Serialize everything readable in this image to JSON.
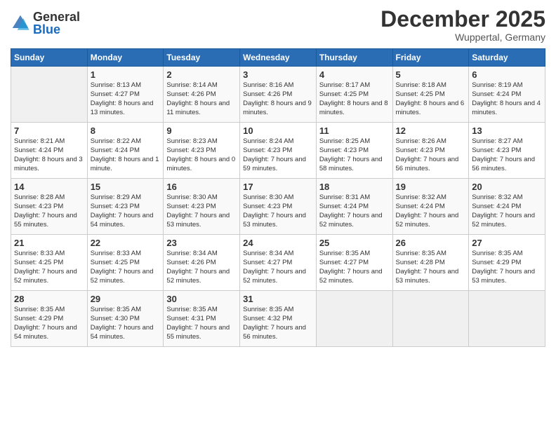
{
  "header": {
    "logo_general": "General",
    "logo_blue": "Blue",
    "month_title": "December 2025",
    "location": "Wuppertal, Germany"
  },
  "weekdays": [
    "Sunday",
    "Monday",
    "Tuesday",
    "Wednesday",
    "Thursday",
    "Friday",
    "Saturday"
  ],
  "weeks": [
    [
      {
        "num": "",
        "empty": true
      },
      {
        "num": "1",
        "sunrise": "Sunrise: 8:13 AM",
        "sunset": "Sunset: 4:27 PM",
        "daylight": "Daylight: 8 hours and 13 minutes."
      },
      {
        "num": "2",
        "sunrise": "Sunrise: 8:14 AM",
        "sunset": "Sunset: 4:26 PM",
        "daylight": "Daylight: 8 hours and 11 minutes."
      },
      {
        "num": "3",
        "sunrise": "Sunrise: 8:16 AM",
        "sunset": "Sunset: 4:26 PM",
        "daylight": "Daylight: 8 hours and 9 minutes."
      },
      {
        "num": "4",
        "sunrise": "Sunrise: 8:17 AM",
        "sunset": "Sunset: 4:25 PM",
        "daylight": "Daylight: 8 hours and 8 minutes."
      },
      {
        "num": "5",
        "sunrise": "Sunrise: 8:18 AM",
        "sunset": "Sunset: 4:25 PM",
        "daylight": "Daylight: 8 hours and 6 minutes."
      },
      {
        "num": "6",
        "sunrise": "Sunrise: 8:19 AM",
        "sunset": "Sunset: 4:24 PM",
        "daylight": "Daylight: 8 hours and 4 minutes."
      }
    ],
    [
      {
        "num": "7",
        "sunrise": "Sunrise: 8:21 AM",
        "sunset": "Sunset: 4:24 PM",
        "daylight": "Daylight: 8 hours and 3 minutes."
      },
      {
        "num": "8",
        "sunrise": "Sunrise: 8:22 AM",
        "sunset": "Sunset: 4:24 PM",
        "daylight": "Daylight: 8 hours and 1 minute."
      },
      {
        "num": "9",
        "sunrise": "Sunrise: 8:23 AM",
        "sunset": "Sunset: 4:23 PM",
        "daylight": "Daylight: 8 hours and 0 minutes."
      },
      {
        "num": "10",
        "sunrise": "Sunrise: 8:24 AM",
        "sunset": "Sunset: 4:23 PM",
        "daylight": "Daylight: 7 hours and 59 minutes."
      },
      {
        "num": "11",
        "sunrise": "Sunrise: 8:25 AM",
        "sunset": "Sunset: 4:23 PM",
        "daylight": "Daylight: 7 hours and 58 minutes."
      },
      {
        "num": "12",
        "sunrise": "Sunrise: 8:26 AM",
        "sunset": "Sunset: 4:23 PM",
        "daylight": "Daylight: 7 hours and 56 minutes."
      },
      {
        "num": "13",
        "sunrise": "Sunrise: 8:27 AM",
        "sunset": "Sunset: 4:23 PM",
        "daylight": "Daylight: 7 hours and 56 minutes."
      }
    ],
    [
      {
        "num": "14",
        "sunrise": "Sunrise: 8:28 AM",
        "sunset": "Sunset: 4:23 PM",
        "daylight": "Daylight: 7 hours and 55 minutes."
      },
      {
        "num": "15",
        "sunrise": "Sunrise: 8:29 AM",
        "sunset": "Sunset: 4:23 PM",
        "daylight": "Daylight: 7 hours and 54 minutes."
      },
      {
        "num": "16",
        "sunrise": "Sunrise: 8:30 AM",
        "sunset": "Sunset: 4:23 PM",
        "daylight": "Daylight: 7 hours and 53 minutes."
      },
      {
        "num": "17",
        "sunrise": "Sunrise: 8:30 AM",
        "sunset": "Sunset: 4:23 PM",
        "daylight": "Daylight: 7 hours and 53 minutes."
      },
      {
        "num": "18",
        "sunrise": "Sunrise: 8:31 AM",
        "sunset": "Sunset: 4:24 PM",
        "daylight": "Daylight: 7 hours and 52 minutes."
      },
      {
        "num": "19",
        "sunrise": "Sunrise: 8:32 AM",
        "sunset": "Sunset: 4:24 PM",
        "daylight": "Daylight: 7 hours and 52 minutes."
      },
      {
        "num": "20",
        "sunrise": "Sunrise: 8:32 AM",
        "sunset": "Sunset: 4:24 PM",
        "daylight": "Daylight: 7 hours and 52 minutes."
      }
    ],
    [
      {
        "num": "21",
        "sunrise": "Sunrise: 8:33 AM",
        "sunset": "Sunset: 4:25 PM",
        "daylight": "Daylight: 7 hours and 52 minutes."
      },
      {
        "num": "22",
        "sunrise": "Sunrise: 8:33 AM",
        "sunset": "Sunset: 4:25 PM",
        "daylight": "Daylight: 7 hours and 52 minutes."
      },
      {
        "num": "23",
        "sunrise": "Sunrise: 8:34 AM",
        "sunset": "Sunset: 4:26 PM",
        "daylight": "Daylight: 7 hours and 52 minutes."
      },
      {
        "num": "24",
        "sunrise": "Sunrise: 8:34 AM",
        "sunset": "Sunset: 4:27 PM",
        "daylight": "Daylight: 7 hours and 52 minutes."
      },
      {
        "num": "25",
        "sunrise": "Sunrise: 8:35 AM",
        "sunset": "Sunset: 4:27 PM",
        "daylight": "Daylight: 7 hours and 52 minutes."
      },
      {
        "num": "26",
        "sunrise": "Sunrise: 8:35 AM",
        "sunset": "Sunset: 4:28 PM",
        "daylight": "Daylight: 7 hours and 53 minutes."
      },
      {
        "num": "27",
        "sunrise": "Sunrise: 8:35 AM",
        "sunset": "Sunset: 4:29 PM",
        "daylight": "Daylight: 7 hours and 53 minutes."
      }
    ],
    [
      {
        "num": "28",
        "sunrise": "Sunrise: 8:35 AM",
        "sunset": "Sunset: 4:29 PM",
        "daylight": "Daylight: 7 hours and 54 minutes."
      },
      {
        "num": "29",
        "sunrise": "Sunrise: 8:35 AM",
        "sunset": "Sunset: 4:30 PM",
        "daylight": "Daylight: 7 hours and 54 minutes."
      },
      {
        "num": "30",
        "sunrise": "Sunrise: 8:35 AM",
        "sunset": "Sunset: 4:31 PM",
        "daylight": "Daylight: 7 hours and 55 minutes."
      },
      {
        "num": "31",
        "sunrise": "Sunrise: 8:35 AM",
        "sunset": "Sunset: 4:32 PM",
        "daylight": "Daylight: 7 hours and 56 minutes."
      },
      {
        "num": "",
        "empty": true
      },
      {
        "num": "",
        "empty": true
      },
      {
        "num": "",
        "empty": true
      }
    ]
  ]
}
